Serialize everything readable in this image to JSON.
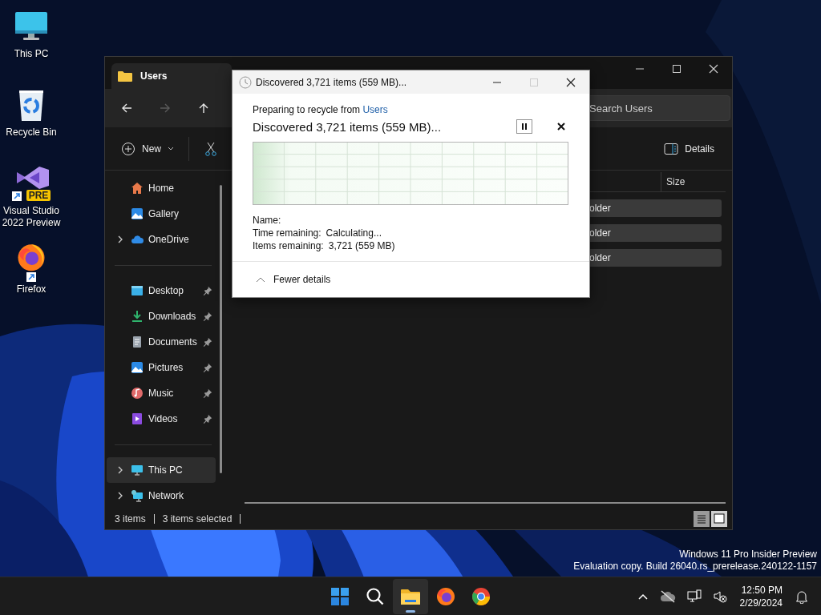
{
  "desktop_icons": [
    {
      "kind": "pc",
      "label": "This PC",
      "shortcut": false
    },
    {
      "kind": "bin",
      "label": "Recycle Bin",
      "shortcut": false
    },
    {
      "kind": "vs",
      "label": "Visual Studio 2022 Preview",
      "badge": "PRE",
      "shortcut": true
    },
    {
      "kind": "firefox",
      "label": "Firefox",
      "shortcut": true
    }
  ],
  "explorer": {
    "tab_title": "Users",
    "nav_buttons": [
      {
        "kind": "back",
        "disabled": false
      },
      {
        "kind": "forward",
        "disabled": true
      },
      {
        "kind": "up",
        "disabled": false
      }
    ],
    "search": {
      "placeholder": "Search Users"
    },
    "toolbar": {
      "new_label": "New",
      "details_label": "Details"
    },
    "sidebar": {
      "sections": [
        {
          "items": [
            {
              "kind": "home",
              "label": "Home",
              "expandable": false,
              "pinned": false,
              "selected": false
            },
            {
              "kind": "gallery",
              "label": "Gallery",
              "expandable": false,
              "pinned": false,
              "selected": false
            },
            {
              "kind": "onedrive",
              "label": "OneDrive",
              "expandable": true,
              "pinned": false,
              "selected": false
            }
          ]
        },
        {
          "items": [
            {
              "kind": "desktop",
              "label": "Desktop",
              "expandable": false,
              "pinned": true,
              "selected": false
            },
            {
              "kind": "downloads",
              "label": "Downloads",
              "expandable": false,
              "pinned": true,
              "selected": false
            },
            {
              "kind": "documents",
              "label": "Documents",
              "expandable": false,
              "pinned": true,
              "selected": false
            },
            {
              "kind": "pictures",
              "label": "Pictures",
              "expandable": false,
              "pinned": true,
              "selected": false
            },
            {
              "kind": "music",
              "label": "Music",
              "expandable": false,
              "pinned": true,
              "selected": false
            },
            {
              "kind": "videos",
              "label": "Videos",
              "expandable": false,
              "pinned": true,
              "selected": false
            }
          ]
        },
        {
          "items": [
            {
              "kind": "thispc",
              "label": "This PC",
              "expandable": true,
              "pinned": false,
              "selected": true
            },
            {
              "kind": "network",
              "label": "Network",
              "expandable": true,
              "pinned": false,
              "selected": false
            }
          ]
        }
      ]
    },
    "table": {
      "columns": [
        {
          "label": "Size"
        }
      ],
      "rows": [
        {
          "column_2": "older",
          "selected": true
        },
        {
          "column_2": "older",
          "selected": true
        },
        {
          "column_2": "older",
          "selected": true
        }
      ]
    },
    "status_bar": {
      "item_count": "3 items",
      "selection": "3 items selected"
    },
    "view_buttons": [
      {
        "kind": "details",
        "selected": true
      },
      {
        "kind": "tiles",
        "selected": false
      }
    ]
  },
  "dialog": {
    "title": "Discovered 3,721 items (559 MB)...",
    "source_prefix": "Preparing to recycle from ",
    "source_link": "Users",
    "heading": "Discovered 3,721 items (559 MB)...",
    "details": [
      {
        "label": "Name:"
      },
      {
        "label": "Time remaining:",
        "value": "Calculating..."
      },
      {
        "label": "Items remaining:",
        "value": "3,721 (559 MB)"
      }
    ],
    "details_toggle": {
      "label": "Fewer details",
      "expanded": true
    }
  },
  "watermark": [
    "Windows 11 Pro Insider Preview",
    "Evaluation copy. Build 26040.rs_prerelease.240122-1157"
  ],
  "taskbar": {
    "apps": [
      {
        "kind": "start",
        "active": false
      },
      {
        "kind": "search",
        "active": false
      },
      {
        "kind": "explorer",
        "active": true
      },
      {
        "kind": "firefox",
        "active": false
      },
      {
        "kind": "chrome",
        "active": false
      }
    ],
    "time": "12:50 PM",
    "date": "2/29/2024"
  }
}
